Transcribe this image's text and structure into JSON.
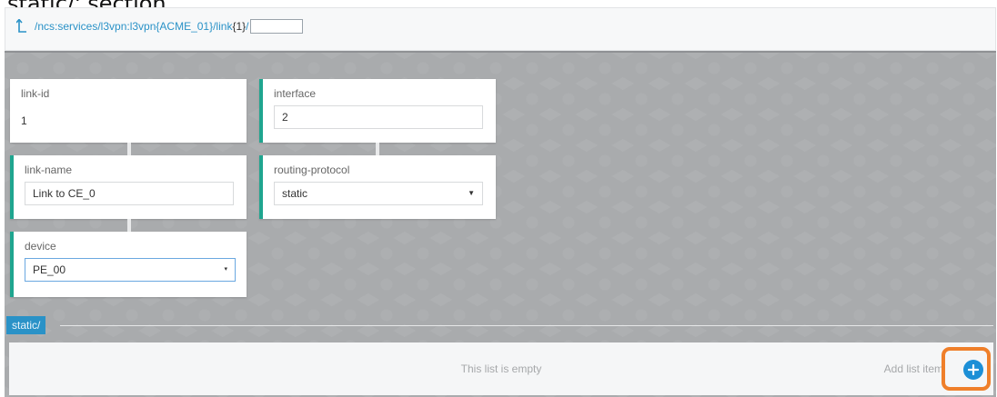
{
  "caption": "static/' section.",
  "breadcrumb": {
    "icon": "up-arrow-icon",
    "path_prefix": "/ncs:services/l3vpn:l3vpn{ACME_01}/link",
    "path_key": "{1}",
    "path_suffix": "/",
    "input_value": ""
  },
  "fields": {
    "link_id": {
      "label": "link-id",
      "value": "1"
    },
    "interface": {
      "label": "interface",
      "value": "2"
    },
    "link_name": {
      "label": "link-name",
      "value": "Link to CE_0"
    },
    "routing_protocol": {
      "label": "routing-protocol",
      "value": "static"
    },
    "device": {
      "label": "device",
      "value": "PE_00"
    }
  },
  "section": {
    "tab_label": "static/",
    "empty_text": "This list is empty",
    "add_label": "Add list item"
  },
  "colors": {
    "accent": "#2a92c7",
    "edit_bar": "#1fa58f",
    "highlight": "#ef7f2a",
    "add_button": "#1c8fd6"
  }
}
